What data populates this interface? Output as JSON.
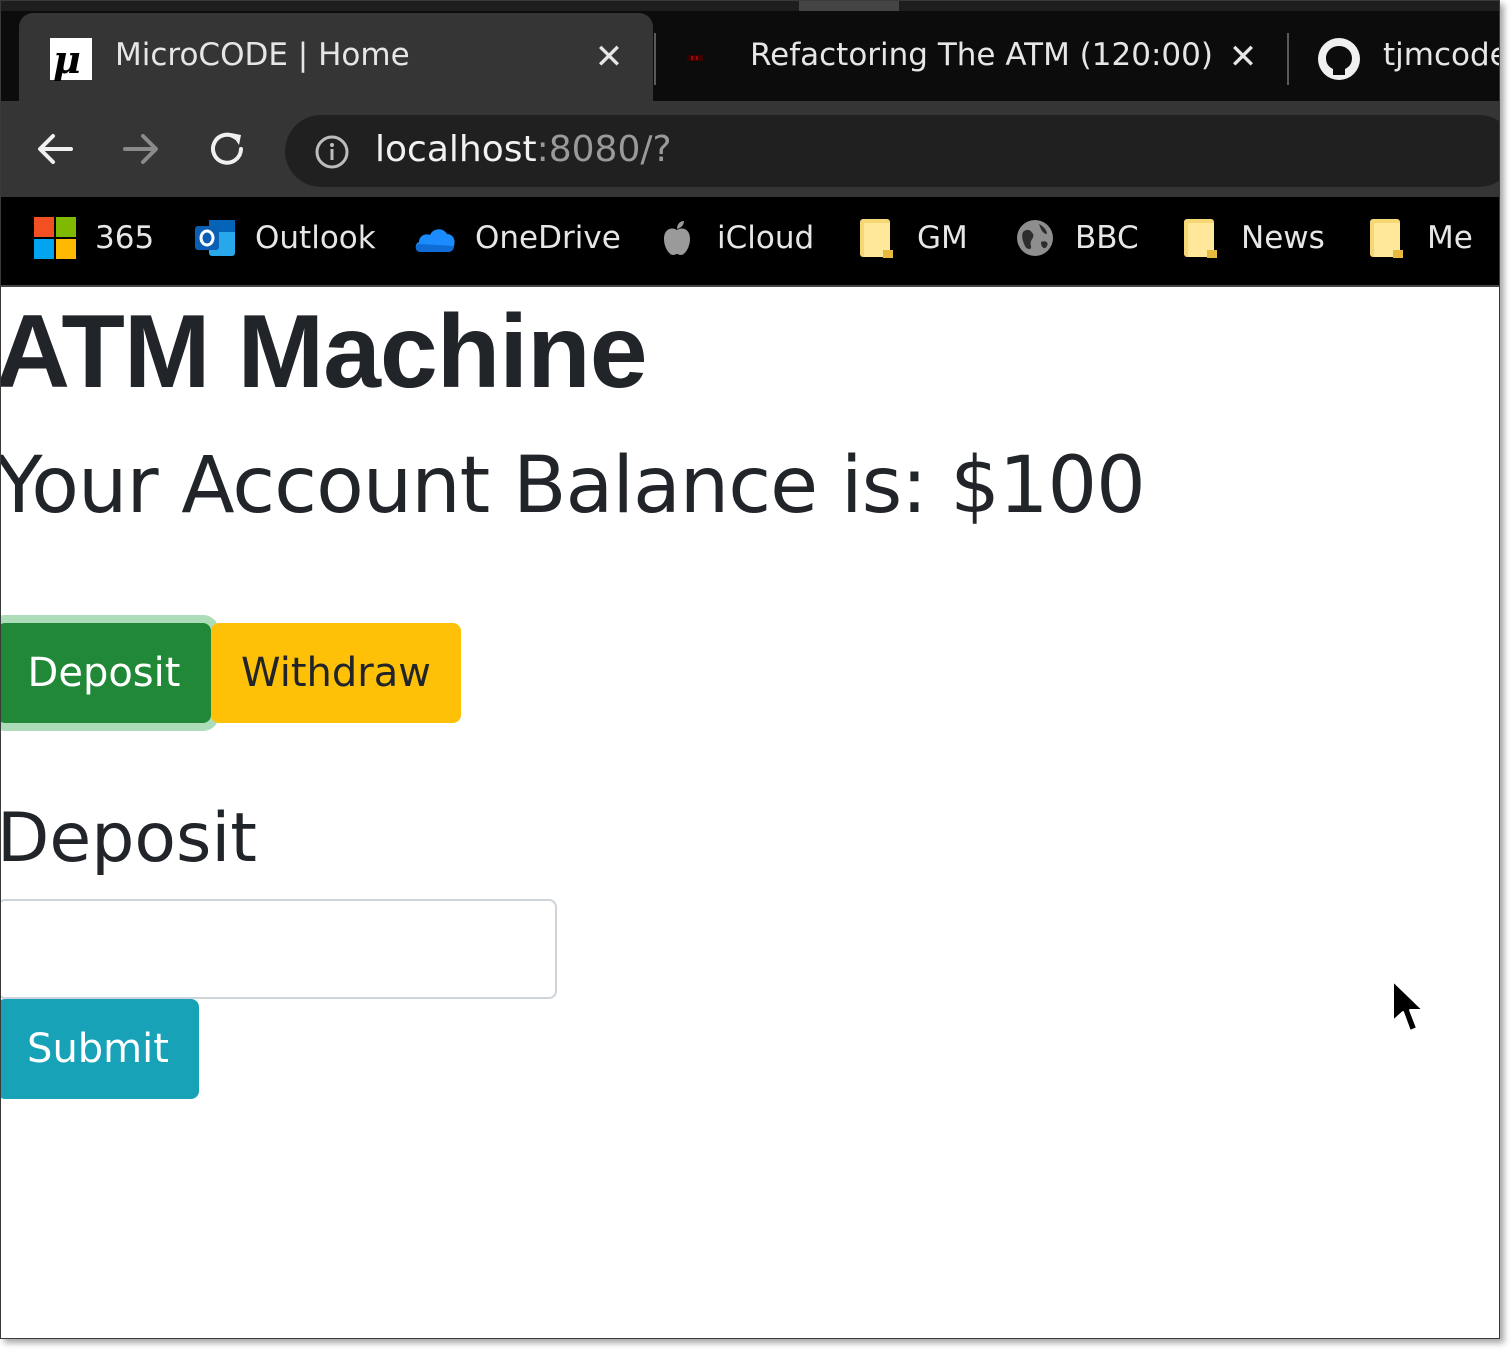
{
  "browser": {
    "tabs": [
      {
        "title": "MicroCODE | Home",
        "favicon": "microcode-mu-icon",
        "close": "✕",
        "active": true
      },
      {
        "title": "Refactoring The ATM (120:00)",
        "favicon": "timer-icon",
        "close": "✕",
        "active": false
      },
      {
        "title": "tjmcode,",
        "favicon": "github-icon",
        "active": false
      }
    ],
    "url": {
      "host": "localhost",
      "rest": ":8080/?"
    },
    "bookmarks": [
      {
        "label": "365",
        "icon": "microsoft-365-icon"
      },
      {
        "label": "Outlook",
        "icon": "outlook-icon"
      },
      {
        "label": "OneDrive",
        "icon": "onedrive-cloud-icon"
      },
      {
        "label": "iCloud",
        "icon": "apple-icon"
      },
      {
        "label": "GM",
        "icon": "folder-icon"
      },
      {
        "label": "BBC",
        "icon": "globe-icon"
      },
      {
        "label": "News",
        "icon": "folder-icon"
      },
      {
        "label": "Me",
        "icon": "folder-icon"
      }
    ]
  },
  "page": {
    "heading": "ATM Machine",
    "balance_text": "Your Account Balance is: $100",
    "buttons": {
      "deposit": "Deposit",
      "withdraw": "Withdraw",
      "submit": "Submit"
    },
    "form": {
      "title": "Deposit",
      "amount_value": ""
    }
  },
  "colors": {
    "deposit": "#218838",
    "withdraw": "#ffc107",
    "submit": "#17a2b8",
    "text": "#212529"
  }
}
